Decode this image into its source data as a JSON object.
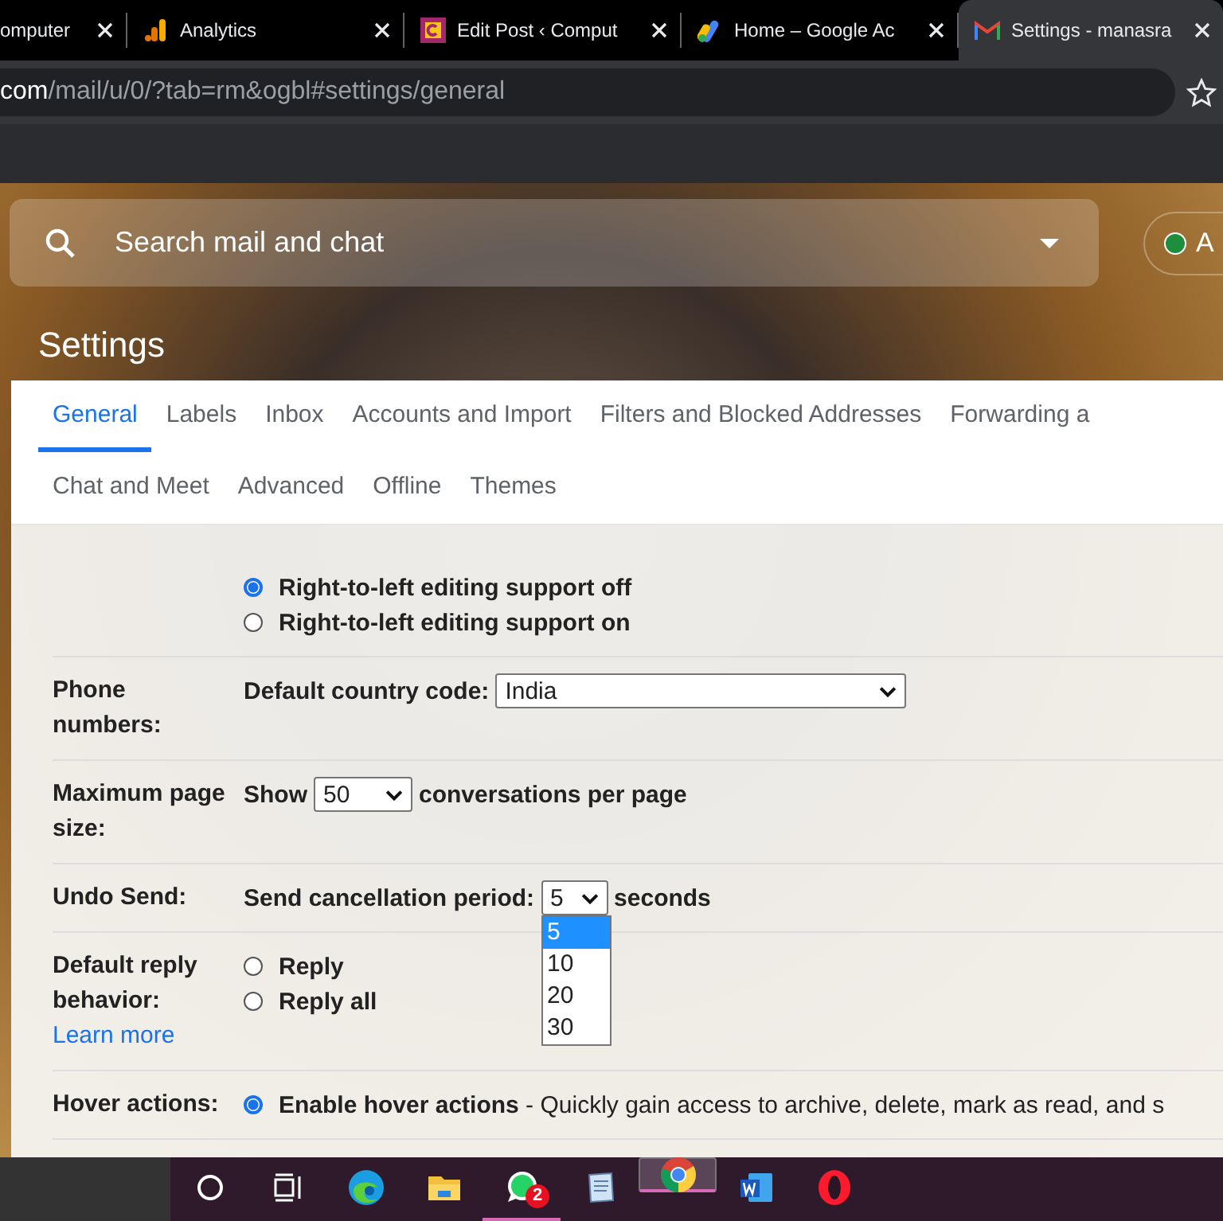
{
  "browser": {
    "tabs": [
      {
        "kind": "none",
        "title": "omputer",
        "selected": false
      },
      {
        "kind": "analytics",
        "title": "Analytics",
        "selected": false
      },
      {
        "kind": "site",
        "title": "Edit Post ‹ Comput",
        "selected": false
      },
      {
        "kind": "ads",
        "title": "Home – Google Ac",
        "selected": false
      },
      {
        "kind": "mail",
        "title": "Settings - manasra",
        "selected": true
      }
    ],
    "address": {
      "host": "com",
      "path": "/mail/u/0/?tab=rm&ogbl#settings/general"
    }
  },
  "search": {
    "placeholder": "Search mail and chat"
  },
  "status": {
    "label": "A",
    "color": "#1e8e3e"
  },
  "page_title": "Settings",
  "settings_tabs": [
    {
      "label": "General",
      "selected": true
    },
    {
      "label": "Labels",
      "selected": false
    },
    {
      "label": "Inbox",
      "selected": false
    },
    {
      "label": "Accounts and Import",
      "selected": false
    },
    {
      "label": "Filters and Blocked Addresses",
      "selected": false
    },
    {
      "label": "Forwarding a",
      "selected": false
    },
    {
      "label": "Chat and Meet",
      "selected": false
    },
    {
      "label": "Advanced",
      "selected": false
    },
    {
      "label": "Offline",
      "selected": false
    },
    {
      "label": "Themes",
      "selected": false
    }
  ],
  "rows": [
    {
      "kind": "radios",
      "options": [
        {
          "label": "Right-to-left editing support off",
          "selected": true
        },
        {
          "label": "Right-to-left editing support on",
          "selected": false
        }
      ]
    },
    {
      "kind": "wide-select",
      "label": "Phone numbers:",
      "before": "Default country code:",
      "value": "India"
    },
    {
      "kind": "select",
      "label": "Maximum page size:",
      "before": "Show",
      "value": "50",
      "after": "conversations per page"
    },
    {
      "kind": "select",
      "label": "Undo Send:",
      "before": "Send cancellation period:",
      "value": "5",
      "after": "seconds",
      "open": true,
      "options": [
        {
          "label": "5",
          "selected": true
        },
        {
          "label": "10",
          "selected": false
        },
        {
          "label": "20",
          "selected": false
        },
        {
          "label": "30",
          "selected": false
        }
      ]
    },
    {
      "kind": "radios",
      "label": "Default reply behavior:",
      "link": "Learn more",
      "options": [
        {
          "label": "Reply",
          "selected": false
        },
        {
          "label": "Reply all",
          "selected": false
        }
      ]
    },
    {
      "kind": "radios",
      "label": "Hover actions:",
      "options": [
        {
          "label": "Enable hover actions",
          "description": " - Quickly gain access to archive, delete, mark as read, and s",
          "selected": true
        }
      ]
    }
  ],
  "taskbar": [
    {
      "kind": "search",
      "running": false,
      "selected": false
    },
    {
      "kind": "task-view",
      "running": false,
      "selected": false
    },
    {
      "kind": "edge",
      "running": false,
      "selected": false
    },
    {
      "kind": "folder",
      "running": false,
      "selected": false
    },
    {
      "kind": "chat",
      "running": true,
      "selected": false,
      "badge": "2"
    },
    {
      "kind": "notepad",
      "running": false,
      "selected": false
    },
    {
      "kind": "chrome",
      "running": true,
      "selected": true
    },
    {
      "kind": "word",
      "running": false,
      "selected": false
    },
    {
      "kind": "opera",
      "running": false,
      "selected": false
    }
  ]
}
